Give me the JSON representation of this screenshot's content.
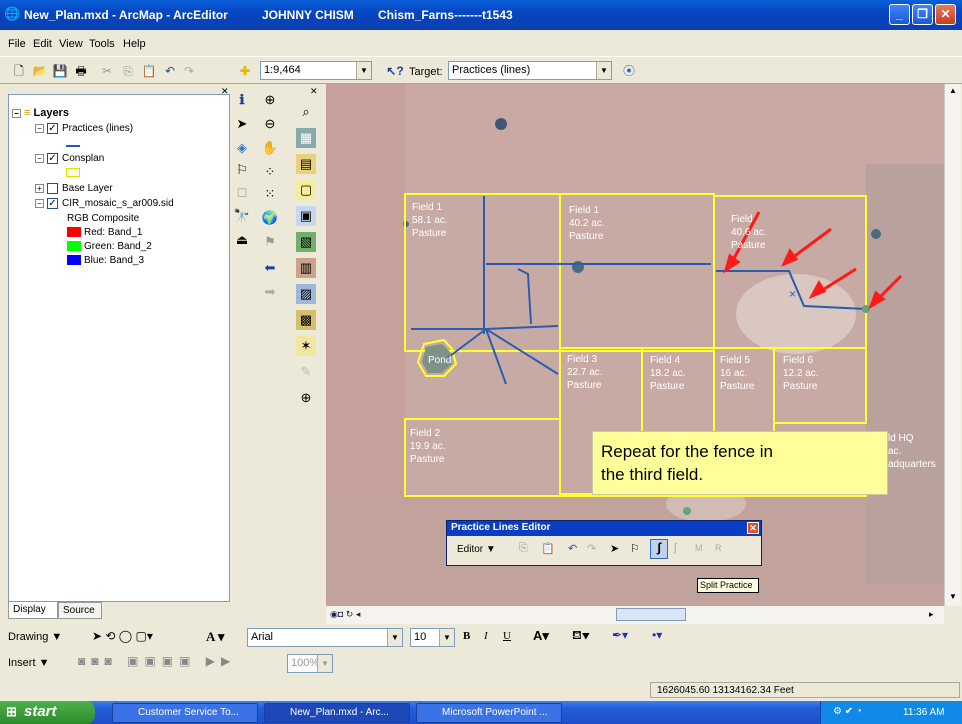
{
  "window": {
    "title": "New_Plan.mxd - ArcMap - ArcEditor",
    "user": "JOHNNY CHISM",
    "farm": "Chism_Farns-------t1543",
    "btn_min": "_",
    "btn_max": "❐",
    "btn_close": "✕"
  },
  "menu": [
    "File",
    "Edit",
    "View",
    "Tools",
    "Help"
  ],
  "toolbar": {
    "scale": "1:9,464",
    "target_label": "Target:",
    "target_value": "Practices (lines)"
  },
  "toc": {
    "root": "Layers",
    "items": [
      {
        "label": "Practices (lines)"
      },
      {
        "label": "Consplan"
      },
      {
        "label": "Base Layer"
      },
      {
        "label": "CIR_mosaic_s_ar009.sid"
      },
      {
        "label": "RGB Composite"
      },
      {
        "label": "Red:   Band_1"
      },
      {
        "label": "Green: Band_2"
      },
      {
        "label": "Blue:  Band_3"
      }
    ],
    "swatch_colors": {
      "red": "#ff0000",
      "green": "#00ff00",
      "blue": "#0000ff",
      "consplan": "#ffff66"
    },
    "tab_display": "Display",
    "tab_source": "Source"
  },
  "map": {
    "fields": [
      {
        "name": "Field  1",
        "acres": "58.1 ac.",
        "use": "Pasture"
      },
      {
        "name": "Field  1",
        "acres": "40.2 ac.",
        "use": "Pasture"
      },
      {
        "name": "Field",
        "acres": "40.6 ac.",
        "use": "Pasture"
      },
      {
        "name": "Field  3",
        "acres": "22.7 ac.",
        "use": "Pasture"
      },
      {
        "name": "Field  4",
        "acres": "18.2 ac.",
        "use": "Pasture"
      },
      {
        "name": "Field  5",
        "acres": "16 ac.",
        "use": "Pasture"
      },
      {
        "name": "Field  6",
        "acres": "12.2 ac.",
        "use": "Pasture"
      },
      {
        "name": "Field  2",
        "acres": "19.9 ac.",
        "use": "Pasture"
      },
      {
        "name": "ld HQ",
        "acres": "ac.",
        "use": "adquarters"
      }
    ],
    "pond": "Pond",
    "boundary_color": "#ffff33",
    "fence_color": "#2a5db0",
    "arrow_color": "#ff1a1a"
  },
  "callout": {
    "line1": "Repeat for the fence in",
    "line2": "the third field."
  },
  "editor": {
    "title": "Practice Lines Editor",
    "menu": "Editor ▼",
    "tooltip": "Split Practice"
  },
  "drawbar": {
    "drawing": "Drawing ▼",
    "font": "Arial",
    "size": "10"
  },
  "insertbar": {
    "insert": "Insert ▼",
    "zoom": "100%"
  },
  "status": {
    "coords": "1626045.60  13134162.34 Feet"
  },
  "taskbar": {
    "start": "start",
    "tasks": [
      "Customer Service To...",
      "New_Plan.mxd - Arc...",
      "Microsoft PowerPoint ..."
    ],
    "time": "11:36 AM"
  }
}
